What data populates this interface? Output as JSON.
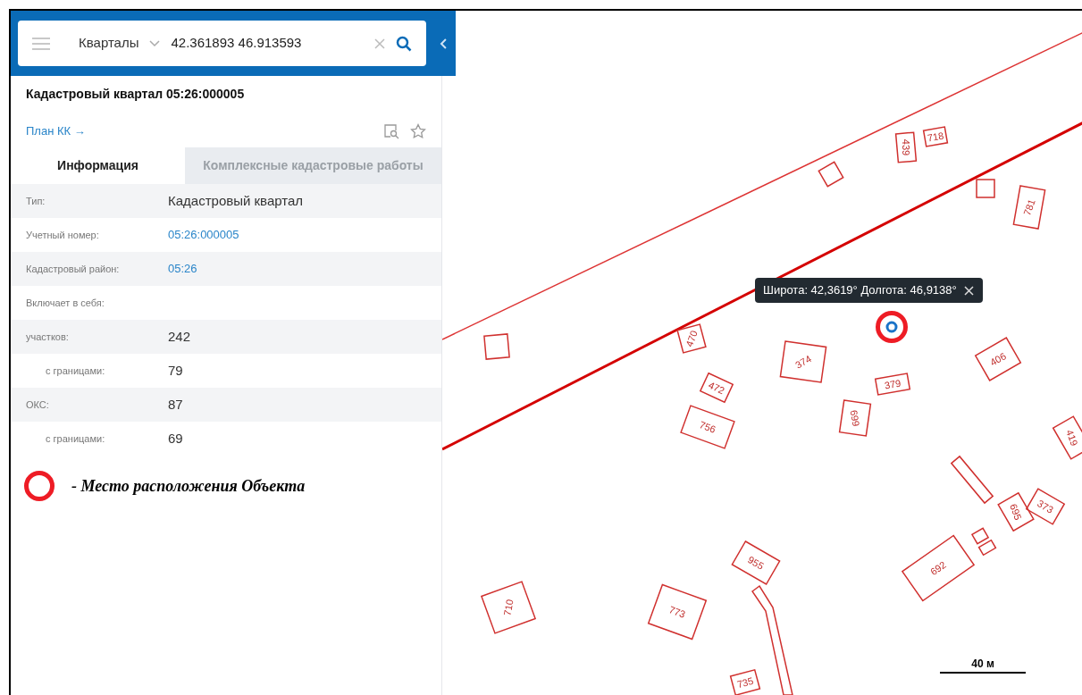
{
  "search": {
    "layer": "Кварталы",
    "value": "42.361893 46.913593"
  },
  "panel": {
    "title": "Кадастровый квартал 05:26:000005",
    "link": "План КК →",
    "tabs": [
      {
        "label": "Информация",
        "selected": true
      },
      {
        "label": "Комплексные кадастровые работы",
        "selected": false
      }
    ],
    "rows": [
      {
        "label": "Тип:",
        "value": "Кадастровый квартал",
        "kind": "text"
      },
      {
        "label": "Учетный номер:",
        "value": "05:26:000005",
        "kind": "link"
      },
      {
        "label": "Кадастровый район:",
        "value": "05:26",
        "kind": "link"
      },
      {
        "label": "Включает в себя:",
        "kind": "heading"
      },
      {
        "label": "участков:",
        "value": "242",
        "kind": "text",
        "children": [
          {
            "label": "с границами:",
            "value": "79",
            "kind": "text"
          }
        ]
      },
      {
        "label": "ОКС:",
        "value": "87",
        "kind": "text",
        "children": [
          {
            "label": "с границами:",
            "value": "69",
            "kind": "text"
          }
        ]
      }
    ]
  },
  "legend": {
    "text": "- Место расположения Объекта"
  },
  "map": {
    "tooltip": "Широта: 42,3619° Долгота: 46,9138°",
    "scale": "40 м",
    "parcels": [
      {
        "label": "439"
      },
      {
        "label": "718"
      },
      {
        "label": "781"
      },
      {
        "label": "470"
      },
      {
        "label": "374"
      },
      {
        "label": "379"
      },
      {
        "label": "406"
      },
      {
        "label": "472"
      },
      {
        "label": "756"
      },
      {
        "label": "699"
      },
      {
        "label": "419"
      },
      {
        "label": "710"
      },
      {
        "label": "773"
      },
      {
        "label": "955"
      },
      {
        "label": "735"
      },
      {
        "label": "692"
      },
      {
        "label": "695"
      },
      {
        "label": "373"
      }
    ]
  }
}
